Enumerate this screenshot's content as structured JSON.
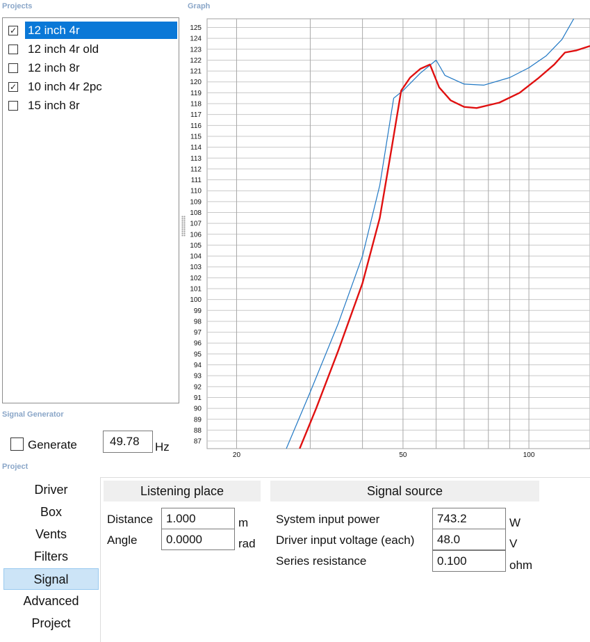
{
  "sections": {
    "projects": "Projects",
    "graph": "Graph",
    "signal_generator": "Signal Generator",
    "project": "Project"
  },
  "projects": [
    {
      "label": "12 inch 4r",
      "checked": true,
      "selected": true
    },
    {
      "label": "12 inch 4r old",
      "checked": false,
      "selected": false
    },
    {
      "label": "12 inch 8r",
      "checked": false,
      "selected": false
    },
    {
      "label": "10 inch 4r 2pc",
      "checked": true,
      "selected": false
    },
    {
      "label": "15 inch 8r",
      "checked": false,
      "selected": false
    }
  ],
  "graph": {
    "chart_data": {
      "type": "line",
      "x_scale": "log",
      "xlim": [
        17,
        140
      ],
      "ylim": [
        86.3,
        125.8
      ],
      "x_tick_labels": [
        "20",
        "50",
        "100"
      ],
      "x_ticks": [
        20,
        50,
        100
      ],
      "y_ticks": [
        87,
        88,
        89,
        90,
        91,
        92,
        93,
        94,
        95,
        96,
        97,
        98,
        99,
        100,
        101,
        102,
        103,
        104,
        105,
        106,
        107,
        108,
        109,
        110,
        111,
        112,
        113,
        114,
        115,
        116,
        117,
        118,
        119,
        120,
        121,
        122,
        123,
        124,
        125
      ],
      "series": [
        {
          "color": "#1f77c4",
          "points": [
            [
              26.3,
              86.3
            ],
            [
              30,
              91.5
            ],
            [
              35,
              97.8
            ],
            [
              40,
              104.0
            ],
            [
              44,
              110.5
            ],
            [
              47.5,
              118.5
            ],
            [
              50,
              119.2
            ],
            [
              55,
              120.8
            ],
            [
              60,
              122.0
            ],
            [
              63,
              120.6
            ],
            [
              70,
              119.8
            ],
            [
              78,
              119.7
            ],
            [
              90,
              120.4
            ],
            [
              100,
              121.3
            ],
            [
              110,
              122.4
            ],
            [
              120,
              123.9
            ],
            [
              128,
              125.8
            ]
          ]
        },
        {
          "color": "#e01010",
          "points": [
            [
              28.3,
              86.3
            ],
            [
              31,
              90.0
            ],
            [
              35,
              95.3
            ],
            [
              40,
              101.5
            ],
            [
              44,
              107.5
            ],
            [
              47,
              114.0
            ],
            [
              49.5,
              119.2
            ],
            [
              52,
              120.4
            ],
            [
              55,
              121.2
            ],
            [
              58,
              121.6
            ],
            [
              61,
              119.5
            ],
            [
              65,
              118.3
            ],
            [
              70,
              117.7
            ],
            [
              75,
              117.6
            ],
            [
              85,
              118.1
            ],
            [
              95,
              119.0
            ],
            [
              105,
              120.3
            ],
            [
              115,
              121.6
            ],
            [
              122,
              122.7
            ],
            [
              130,
              122.9
            ],
            [
              140,
              123.3
            ]
          ]
        }
      ]
    }
  },
  "signal_generator": {
    "generate_label": "Generate",
    "generate_checked": false,
    "frequency": "49.78",
    "unit": "Hz"
  },
  "nav": {
    "items": [
      "Driver",
      "Box",
      "Vents",
      "Filters",
      "Signal",
      "Advanced",
      "Project"
    ],
    "active": "Signal"
  },
  "listening_place": {
    "header": "Listening place",
    "distance_label": "Distance",
    "distance_value": "1.000",
    "distance_unit": "m",
    "angle_label": "Angle",
    "angle_value": "0.0000",
    "angle_unit": "rad"
  },
  "signal_source": {
    "header": "Signal source",
    "power_label": "System input power",
    "power_value": "743.2",
    "power_unit": "W",
    "voltage_label": "Driver input voltage (each)",
    "voltage_value": "48.0",
    "voltage_unit": "V",
    "resistance_label": "Series resistance",
    "resistance_value": "0.100",
    "resistance_unit": "ohm"
  }
}
